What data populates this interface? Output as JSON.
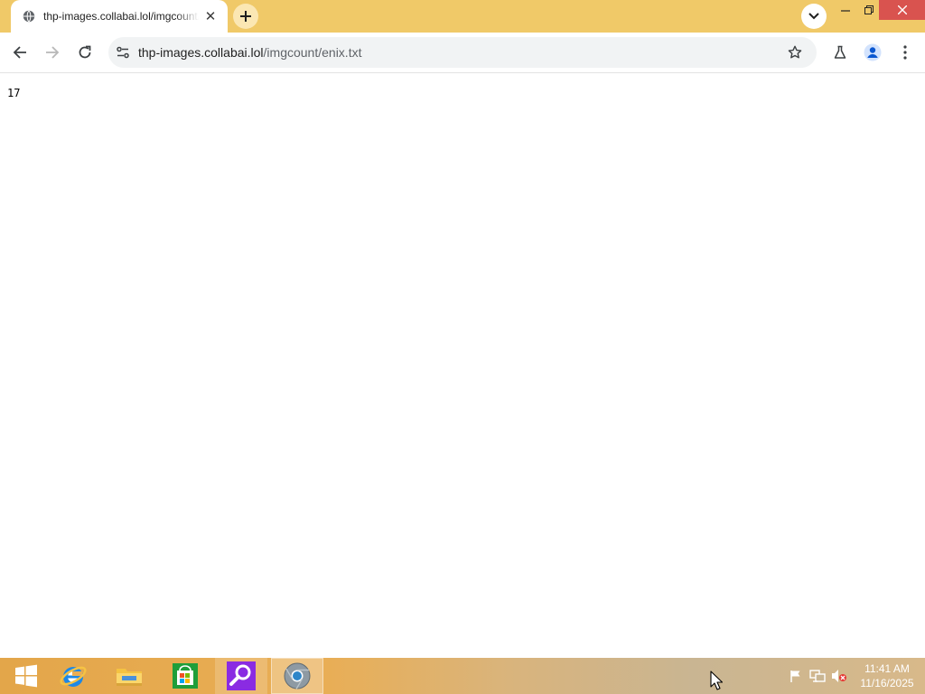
{
  "browser": {
    "tab": {
      "title": "thp-images.collabai.lol/imgcount/enix.txt",
      "favicon": "globe-icon"
    },
    "omnibox": {
      "url_host": "thp-images.collabai.lol",
      "url_path": "/imgcount/enix.txt"
    }
  },
  "page": {
    "text": "17"
  },
  "taskbar": {
    "items": [
      "start-icon",
      "internet-explorer-icon",
      "file-explorer-icon",
      "store-icon",
      "search-app-icon",
      "chrome-icon"
    ],
    "clock_time": "11:41 AM",
    "clock_date": "11/16/2025"
  },
  "colors": {
    "tabstrip": "#f0c968",
    "taskbar_start": "#e3a64a",
    "window_close": "#d9534f"
  }
}
